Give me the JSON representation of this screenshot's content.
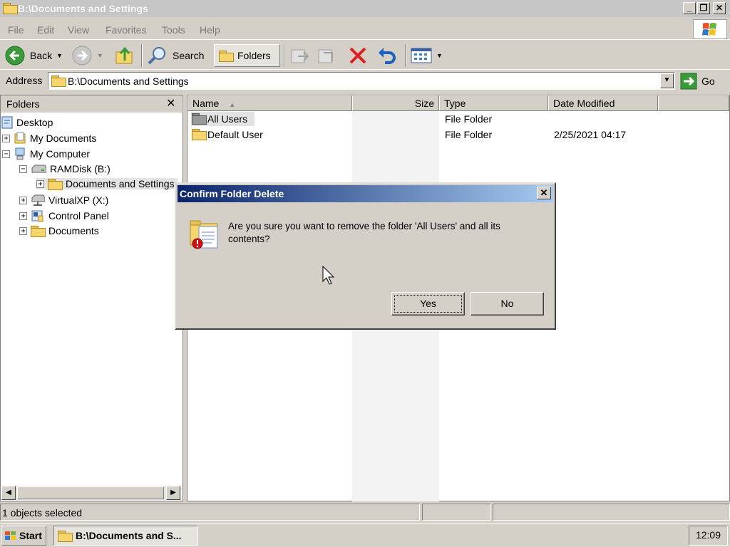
{
  "window": {
    "title": "B:\\Documents and Settings"
  },
  "menu": [
    "File",
    "Edit",
    "View",
    "Favorites",
    "Tools",
    "Help"
  ],
  "toolbar": {
    "back": "Back",
    "search": "Search",
    "folders": "Folders"
  },
  "address": {
    "label": "Address",
    "value": "B:\\Documents and Settings",
    "go": "Go"
  },
  "folders_pane": {
    "title": "Folders",
    "tree": [
      {
        "label": "Desktop"
      },
      {
        "label": "My Documents"
      },
      {
        "label": "My Computer"
      },
      {
        "label": "RAMDisk (B:)"
      },
      {
        "label": "Documents and Settings"
      },
      {
        "label": "VirtualXP (X:)"
      },
      {
        "label": "Control Panel"
      },
      {
        "label": "Documents"
      }
    ]
  },
  "list": {
    "columns": [
      "Name",
      "Size",
      "Type",
      "Date Modified"
    ],
    "rows": [
      {
        "name": "All Users",
        "size": "",
        "type": "File Folder",
        "date": ""
      },
      {
        "name": "Default User",
        "size": "",
        "type": "File Folder",
        "date": "2/25/2021 04:17"
      }
    ]
  },
  "dialog": {
    "title": "Confirm Folder Delete",
    "message_line1": "Are you sure you want to remove the folder 'All Users' and all its",
    "message_line2": "contents?",
    "yes": "Yes",
    "no": "No"
  },
  "status": {
    "text": "1 objects selected"
  },
  "taskbar": {
    "start": "Start",
    "task": "B:\\Documents and S...",
    "clock": "12:09"
  }
}
